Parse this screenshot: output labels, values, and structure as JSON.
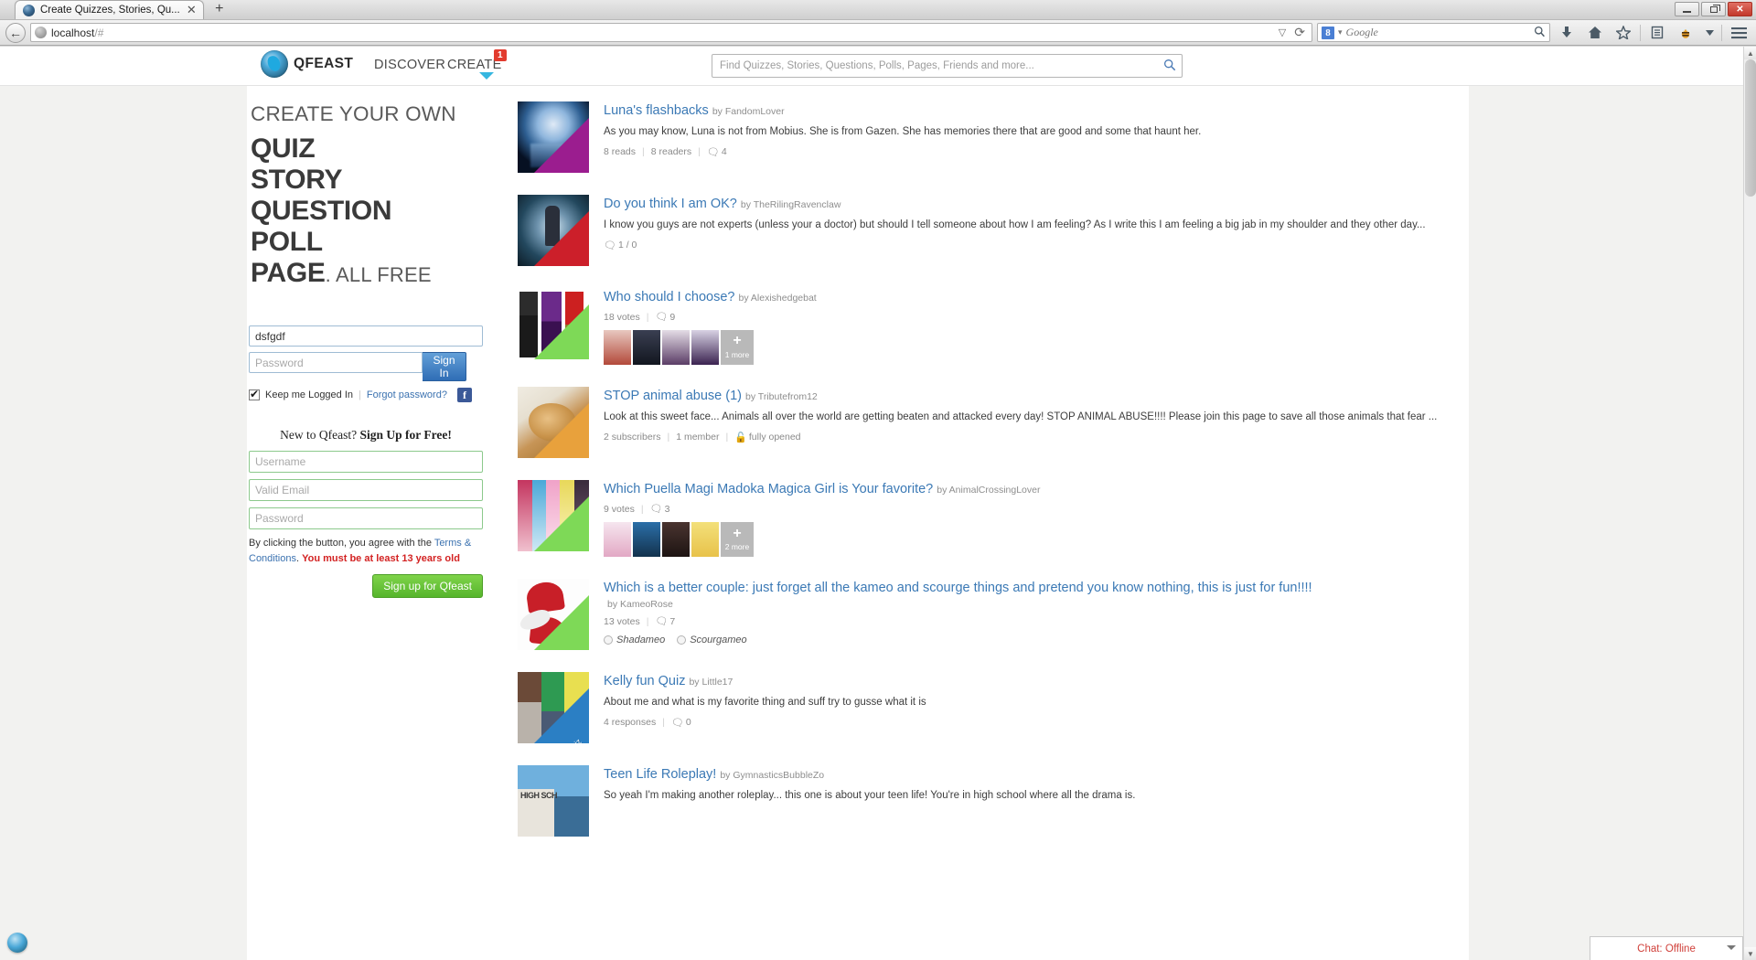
{
  "browser": {
    "tab_title": "Create Quizzes, Stories, Qu...",
    "tab_close": "✕",
    "new_tab": "+",
    "back_arrow": "←",
    "url_host": "localhost",
    "url_path": "/#",
    "reload": "⟳",
    "dropdown_caret": "▽",
    "search_engine": "Google",
    "g_letter": "8",
    "search_magnifier": "⚲",
    "win_minimize": "—",
    "win_restore": "❐",
    "win_close": "✕",
    "toolbar_icons": [
      "download-icon",
      "home-icon",
      "bookmark-star-icon",
      "reading-list-icon",
      "addon-bee-icon",
      "overflow-caret-icon",
      "hamburger-menu-icon"
    ]
  },
  "site": {
    "logo_text": "QFEAST",
    "nav": {
      "discover": "DISCOVER",
      "create": "CREATE",
      "create_badge": "1"
    },
    "search_placeholder": "Find Quizzes, Stories, Questions, Polls, Pages, Friends and more..."
  },
  "promo": {
    "kicker": "CREATE YOUR OWN",
    "lines": [
      "QUIZ",
      "STORY",
      "QUESTION",
      "POLL"
    ],
    "last_line": "PAGE",
    "last_suffix": ". ALL FREE"
  },
  "login": {
    "username_value": "dsfgdf",
    "username_placeholder": "",
    "password_placeholder": "Password",
    "signin_label": "Sign In",
    "keep_logged_label": "Keep me Logged In",
    "forgot_label": "Forgot password?",
    "facebook_label": "f",
    "keep_checked": true
  },
  "signup": {
    "heading_plain": "New to Qfeast? ",
    "heading_bold": "Sign Up for Free!",
    "username_placeholder": "Username",
    "email_placeholder": "Valid Email",
    "password_placeholder": "Password",
    "terms_prefix": "By clicking the button, you agree with the ",
    "terms_link": "Terms & Conditions",
    "terms_dot": ". ",
    "terms_warning": "You must be at least 13 years old",
    "button_label": "Sign up for Qfeast"
  },
  "feed": {
    "items": [
      {
        "title": "Luna's flashbacks",
        "by": "by FandomLover",
        "desc": "As you may know, Luna is not from Mobius. She is from Gazen. She has memories there that are good and some that haunt her.",
        "ribbon": "story",
        "ribbon_color": "#9b1d8f",
        "thumb_style": "moon",
        "meta": [
          "8 reads",
          "8 readers"
        ],
        "comments": "4",
        "options": [],
        "more": "",
        "radios": []
      },
      {
        "title": "Do you think I am OK?",
        "by": "by TheRilingRavenclaw",
        "desc": "I know you guys are not experts (unless your a doctor) but should I tell someone about how I am feeling? As I write this I am feeling a big jab in my shoulder and they other day...",
        "ribbon": "question",
        "ribbon_color": "#cc1f2a",
        "thumb_style": "question",
        "meta": [],
        "comments": "1 / 0",
        "options": [],
        "more": "",
        "radios": []
      },
      {
        "title": "Who should I choose?",
        "by": "by Alexishedgebat",
        "desc": "",
        "ribbon": "poll",
        "ribbon_color": "#7ed957",
        "thumb_style": "characters",
        "meta": [
          "18 votes"
        ],
        "comments": "9",
        "options": [
          "opt1",
          "opt2",
          "opt3",
          "opt4"
        ],
        "more": "1 more",
        "radios": []
      },
      {
        "title": "STOP animal abuse (1)",
        "by": "by Tributefrom12",
        "desc": "Look at this sweet face... Animals all over the world are getting beaten and attacked every day! STOP ANIMAL ABUSE!!!! Please join this page to save all those animals that fear ...",
        "ribbon": "page",
        "ribbon_color": "#e8a13c",
        "thumb_style": "puppy",
        "meta": [
          "2 subscribers",
          "1 member",
          "fully opened"
        ],
        "comments": "",
        "options": [],
        "more": "",
        "radios": []
      },
      {
        "title": "Which Puella Magi Madoka Magica Girl is Your favorite?",
        "by": "by AnimalCrossingLover",
        "desc": "",
        "ribbon": "poll",
        "ribbon_color": "#7ed957",
        "thumb_style": "anime",
        "meta": [
          "9 votes"
        ],
        "comments": "3",
        "options": [
          "opt1",
          "opt2",
          "opt3",
          "opt4"
        ],
        "more": "2 more",
        "radios": []
      },
      {
        "title": "Which is a better couple: just forget all the kameo and scourge things and pretend you know nothing, this is just for fun!!!!",
        "by": "by KameoRose",
        "desc": "",
        "ribbon": "poll",
        "ribbon_color": "#7ed957",
        "thumb_style": "hearts",
        "meta": [
          "13 votes"
        ],
        "comments": "7",
        "options": [],
        "more": "",
        "radios": [
          "Shadameo",
          "Scourgameo"
        ]
      },
      {
        "title": "Kelly fun Quiz",
        "by": "by Little17",
        "desc": "About me and what is my favorite thing and suff try to gusse what it is",
        "ribbon": "scored quiz",
        "ribbon_color": "#2b7fc4",
        "thumb_style": "girls",
        "meta": [
          "4 responses"
        ],
        "comments": "0",
        "options": [],
        "more": "",
        "radios": []
      },
      {
        "title": "Teen Life Roleplay!",
        "by": "by GymnasticsBubbleZo",
        "desc": "So yeah I'm making another roleplay... this one is about your teen life! You're in high school where all the drama is.",
        "ribbon": "",
        "ribbon_color": "#7ed957",
        "thumb_style": "school",
        "meta": [],
        "comments": "",
        "options": [],
        "more": "",
        "radios": []
      }
    ]
  },
  "chat": {
    "label": "Chat: Offline"
  }
}
